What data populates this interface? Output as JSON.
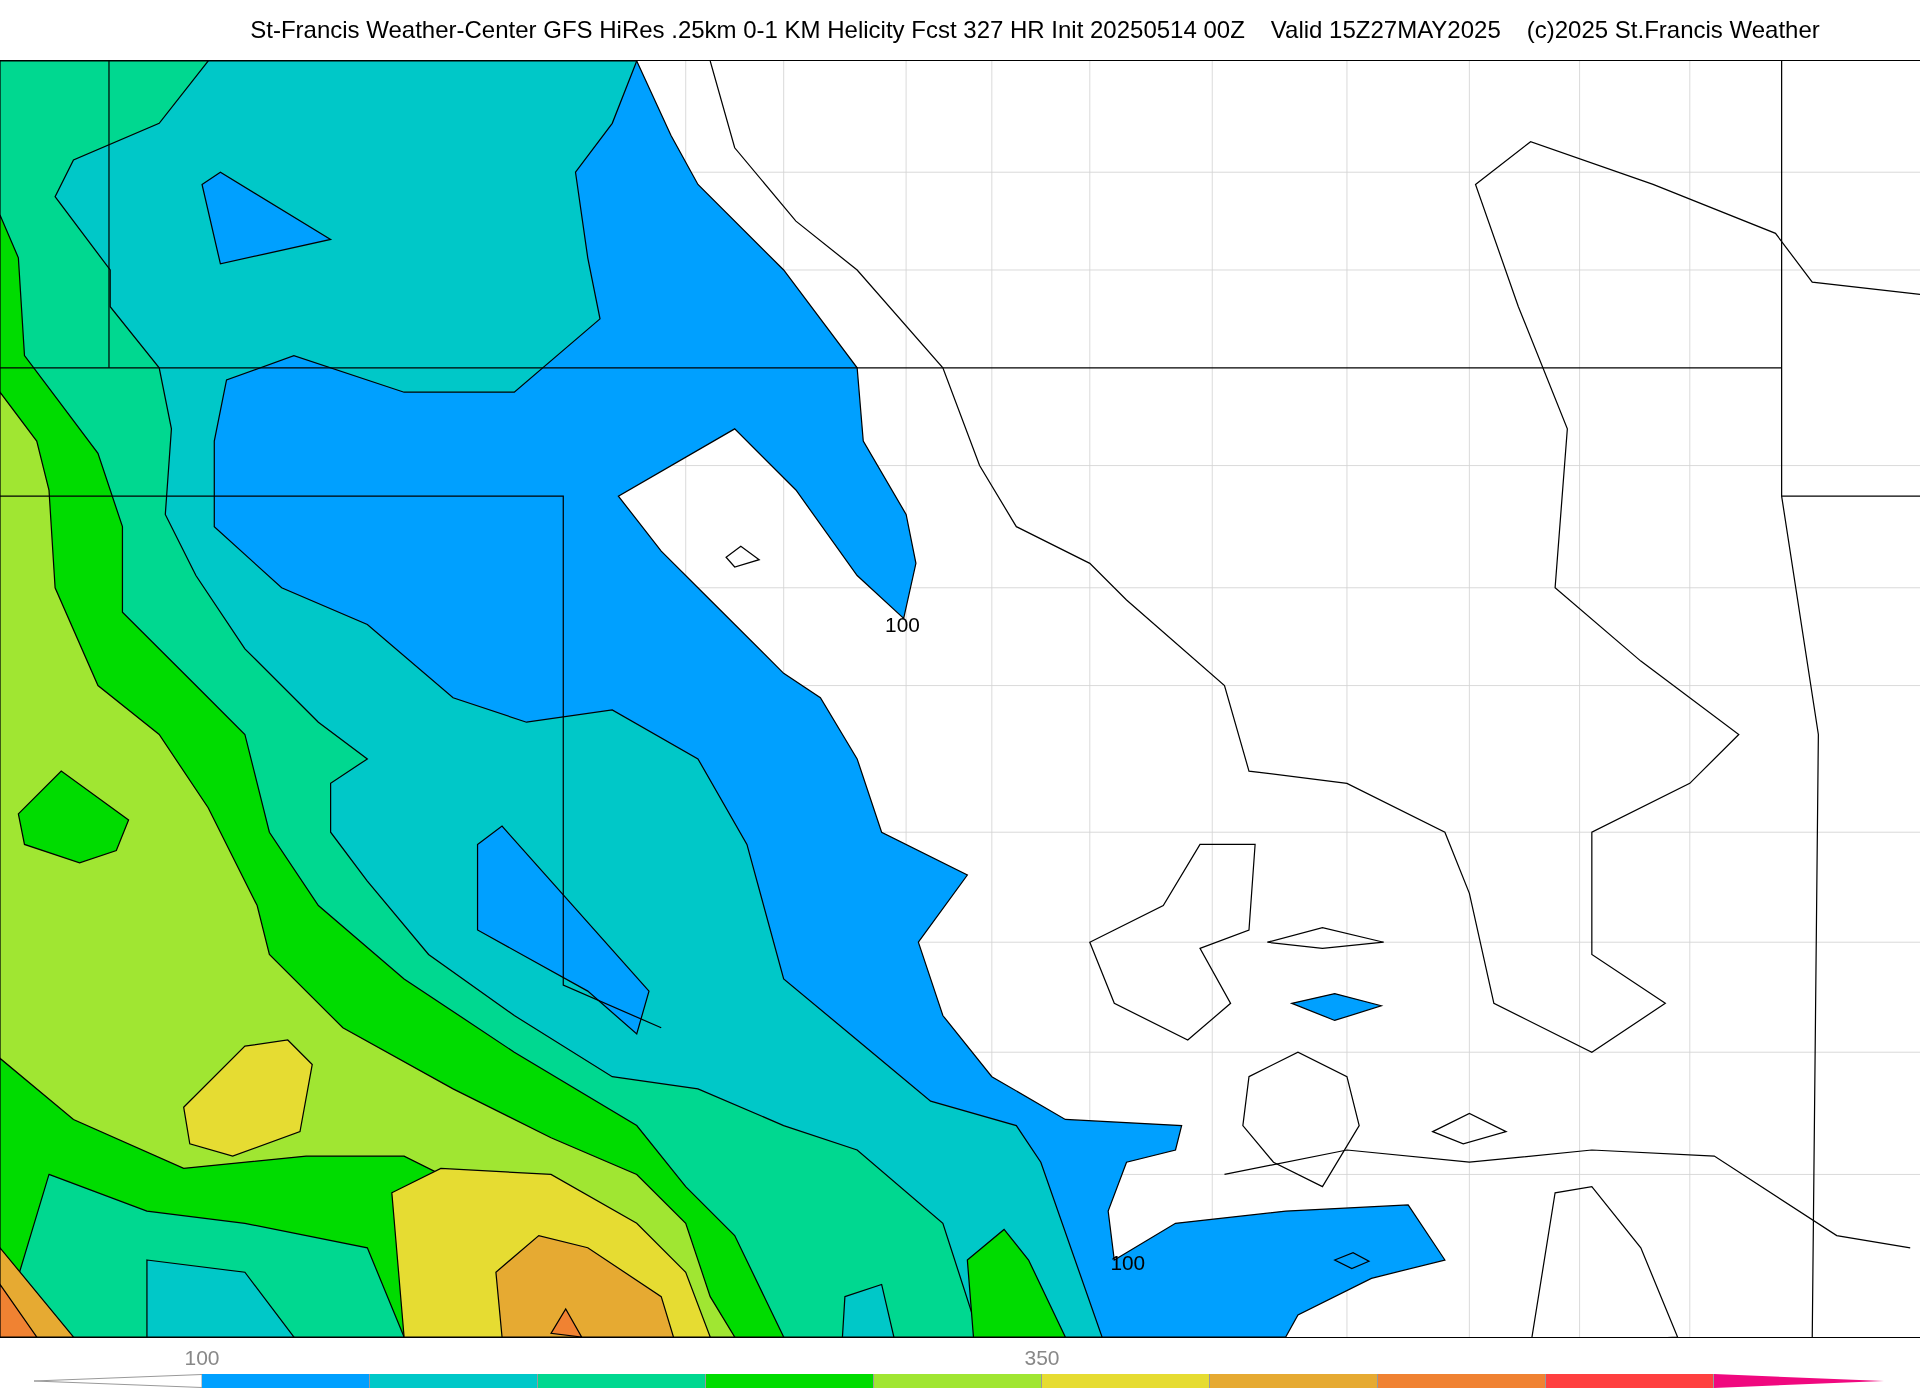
{
  "header": {
    "title": "St-Francis Weather-Center GFS HiRes .25km 0-1 KM Helicity Fcst 327 HR Init 20250514 00Z",
    "valid": "Valid 15Z27MAY2025",
    "copyright": "(c)2025 St.Francis Weather"
  },
  "map": {
    "contour_labels": [
      "100",
      "100"
    ]
  },
  "colorbar": {
    "ticks": [
      "100",
      "350"
    ],
    "bins": [
      {
        "color": "#00a0ff"
      },
      {
        "color": "#00c8c8"
      },
      {
        "color": "#00d890"
      },
      {
        "color": "#00dc00"
      },
      {
        "color": "#a0e632"
      },
      {
        "color": "#e6dc32"
      },
      {
        "color": "#e6aa32"
      },
      {
        "color": "#f08232"
      },
      {
        "color": "#ff4040"
      }
    ],
    "over": {
      "color": "#f0087f"
    }
  }
}
